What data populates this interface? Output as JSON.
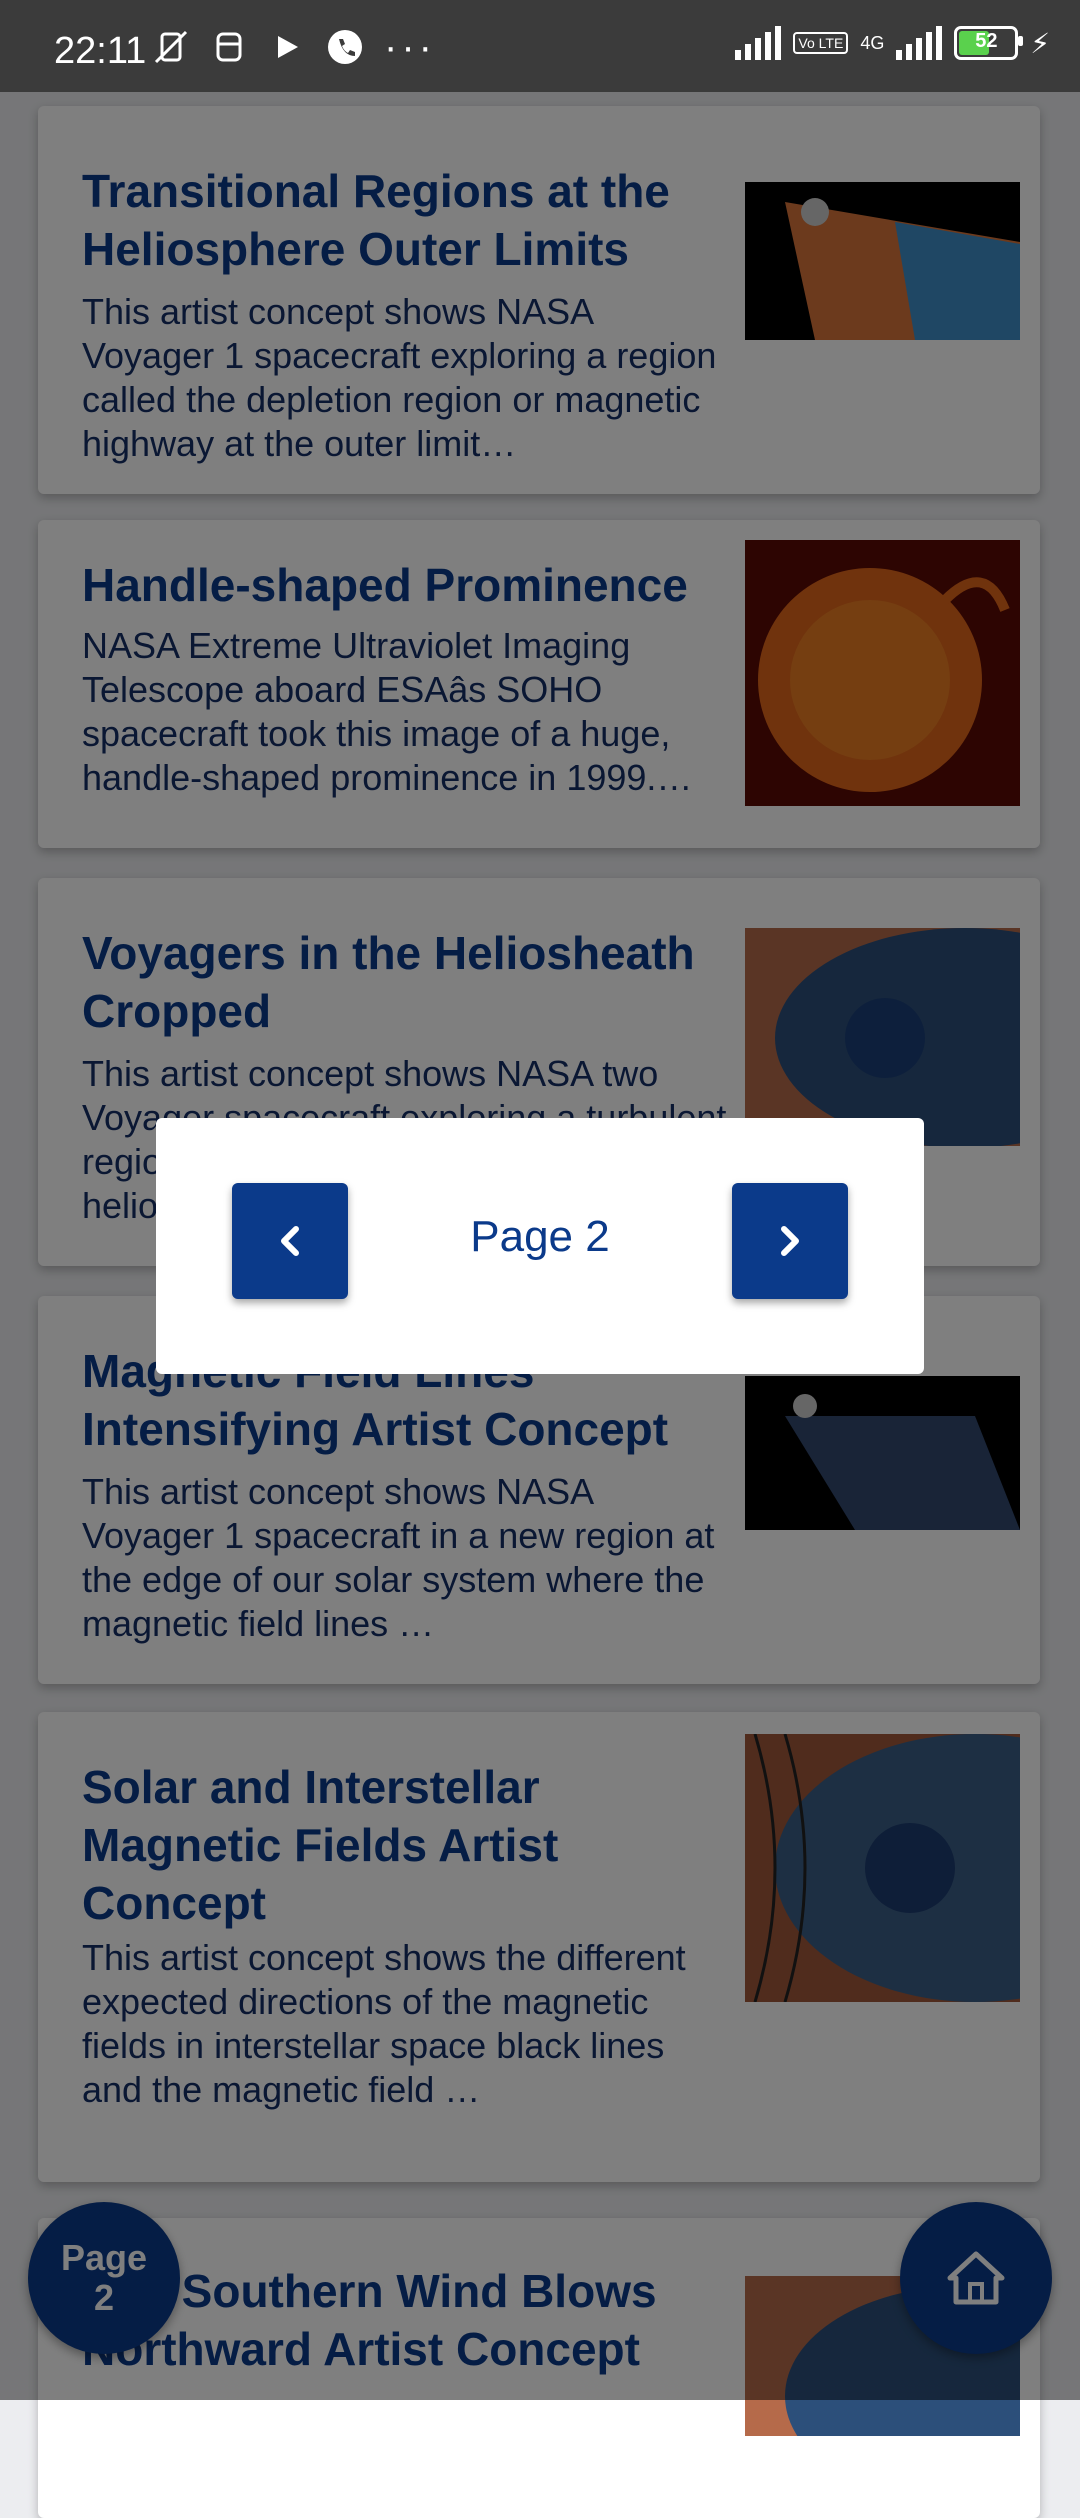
{
  "status_bar": {
    "time": "22:11",
    "network": "4G",
    "volte": "Vo LTE",
    "battery_level": "52",
    "more": "···"
  },
  "articles": [
    {
      "title": "Transitional Regions at the Heliosphere Outer Limits",
      "description": "This artist concept shows NASA Voyager 1 spacecraft exploring a region called the depletion region or magnetic highway at the outer limit…"
    },
    {
      "title": "Handle-shaped Prominence",
      "description": "NASA Extreme Ultraviolet Imaging Telescope aboard ESAâs SOHO spacecraft took this image of a huge, handle-shaped prominence in 1999.…"
    },
    {
      "title": "Voyagers in the Heliosheath Cropped",
      "description": "This artist concept shows NASA two Voyager spacecraft exploring a turbulent region of space known as the heliosheath"
    },
    {
      "title": "Magnetic Field Lines Intensifying Artist Concept",
      "description": "This artist concept shows NASA Voyager 1 spacecraft in a new region at the edge of our solar system where the magnetic field lines …"
    },
    {
      "title": "Solar and Interstellar Magnetic Fields Artist Concept",
      "description": "This artist concept shows the different expected directions of the magnetic fields in interstellar space black lines and the magnetic field …"
    },
    {
      "title": "Sun Southern Wind Blows Northward Artist Concept",
      "description": ""
    }
  ],
  "pagination_dialog": {
    "page_label": "Page 2"
  },
  "fab_page": {
    "line1": "Page",
    "line2": "2"
  },
  "colors": {
    "primary": "#0b3a8a",
    "title_text": "#0b3a8a",
    "body_text": "#142e66",
    "scrim": "rgba(0,0,0,0.5)"
  }
}
